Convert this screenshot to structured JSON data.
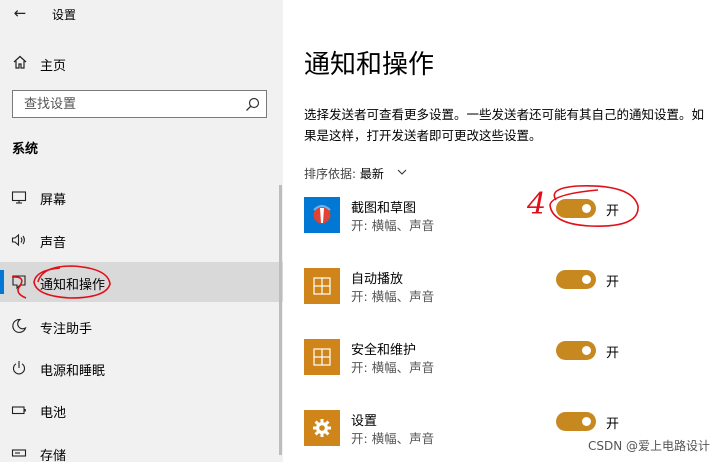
{
  "window": {
    "title": "设置"
  },
  "sidebar": {
    "home_label": "主页",
    "search_placeholder": "查找设置",
    "section_title": "系统",
    "items": [
      {
        "label": "屏幕",
        "icon": "display-icon"
      },
      {
        "label": "声音",
        "icon": "speaker-icon"
      },
      {
        "label": "通知和操作",
        "icon": "notification-icon",
        "active": true
      },
      {
        "label": "专注助手",
        "icon": "moon-icon"
      },
      {
        "label": "电源和睡眠",
        "icon": "power-icon"
      },
      {
        "label": "电池",
        "icon": "battery-icon"
      },
      {
        "label": "存储",
        "icon": "storage-icon"
      }
    ]
  },
  "main": {
    "title": "通知和操作",
    "description": "选择发送者可查看更多设置。一些发送者还可能有其自己的通知设置。如果是这样，打开发送者即可更改这些设置。",
    "sort_label": "排序依据: ",
    "sort_value": "最新",
    "senders": [
      {
        "name": "截图和草图",
        "subtitle": "开: 横幅、声音",
        "toggle_label": "开",
        "on": true,
        "icon": "snip-sketch-icon"
      },
      {
        "name": "自动播放",
        "subtitle": "开: 横幅、声音",
        "toggle_label": "开",
        "on": true,
        "icon": "autoplay-icon"
      },
      {
        "name": "安全和维护",
        "subtitle": "开: 横幅、声音",
        "toggle_label": "开",
        "on": true,
        "icon": "security-maintenance-icon"
      },
      {
        "name": "设置",
        "subtitle": "开: 横幅、声音",
        "toggle_label": "开",
        "on": true,
        "icon": "gear-icon"
      }
    ]
  },
  "annotations": {
    "step_number": "4"
  },
  "watermark": "CSDN @爱上电路设计",
  "colors": {
    "toggle_on": "#c7891f",
    "tile": "#cf8519",
    "accent": "#0078d4",
    "annotation": "#e0101a"
  }
}
